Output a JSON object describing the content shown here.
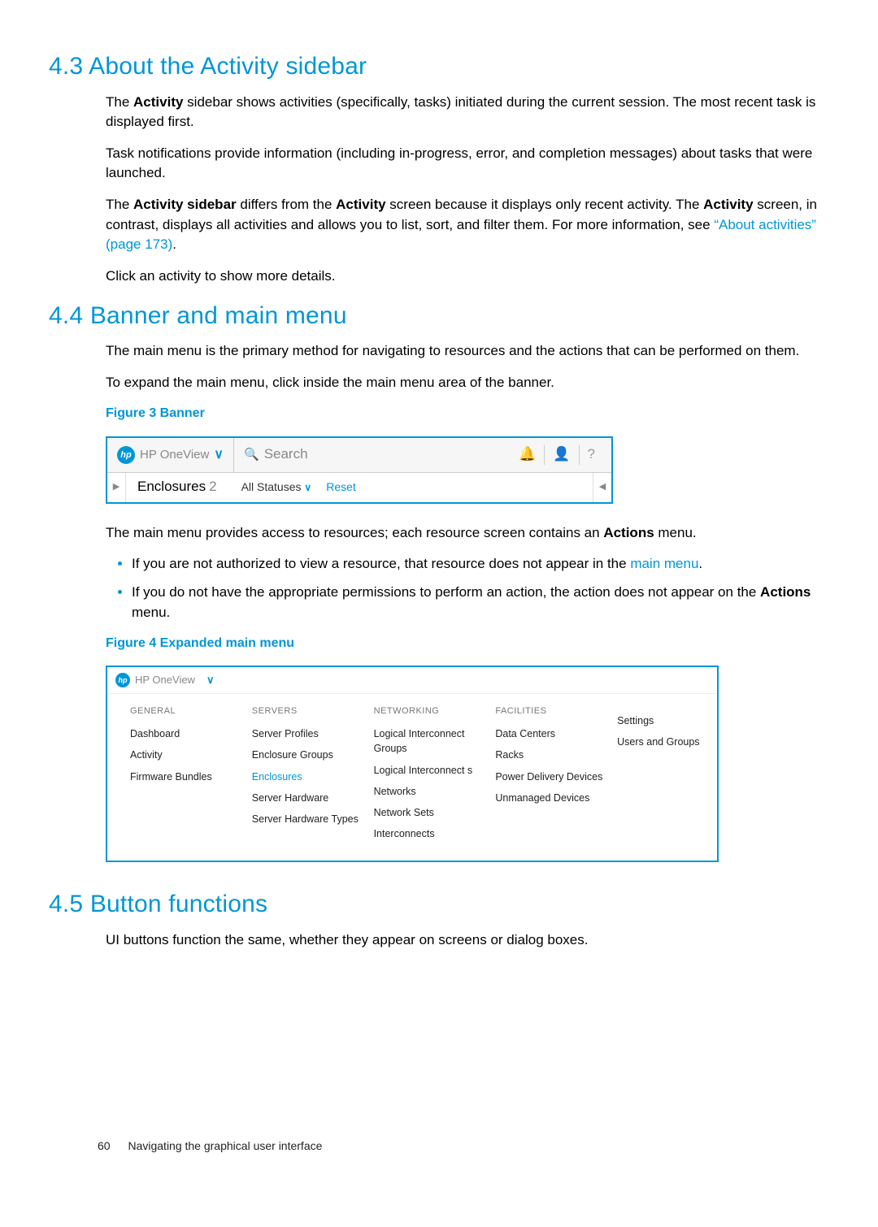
{
  "sections": {
    "s43": {
      "title": "4.3 About the Activity sidebar",
      "p1a": "The ",
      "p1b": "Activity",
      "p1c": " sidebar shows activities (specifically, tasks) initiated during the current session. The most recent task is displayed first.",
      "p2": "Task notifications provide information (including in-progress, error, and completion messages) about tasks that were launched.",
      "p3a": "The ",
      "p3b": "Activity sidebar",
      "p3c": " differs from the ",
      "p3d": "Activity",
      "p3e": " screen because it displays only recent activity. The ",
      "p3f": "Activity",
      "p3g": " screen, in contrast, displays all activities and allows you to list, sort, and filter them. For more information, see ",
      "p3link": "“About activities” (page 173)",
      "p3h": ".",
      "p4": "Click an activity to show more details."
    },
    "s44": {
      "title": "4.4 Banner and main menu",
      "p1": "The main menu is the primary method for navigating to resources and the actions that can be performed on them.",
      "p2": "To expand the main menu, click inside the main menu area of the banner.",
      "fig3": "Figure 3 Banner",
      "after1a": "The main menu provides access to resources; each resource screen contains an ",
      "after1b": "Actions",
      "after1c": " menu.",
      "bullet1a": "If you are not authorized to view a resource, that resource does not appear in the ",
      "bullet1link": "main menu",
      "bullet1b": ".",
      "bullet2a": "If you do not have the appropriate permissions to perform an action, the action does not appear on the ",
      "bullet2b": "Actions",
      "bullet2c": " menu.",
      "fig4": "Figure 4 Expanded main menu"
    },
    "s45": {
      "title": "4.5 Button functions",
      "p1": "UI buttons function the same, whether they appear on screens or dialog boxes."
    }
  },
  "banner": {
    "brand": "HP OneView",
    "logo": "hp",
    "search_placeholder": "Search",
    "bell": "🔔",
    "user": "👤",
    "help": "?",
    "enclosures_label": "Enclosures",
    "enclosures_count": "2",
    "all_statuses": "All Statuses",
    "reset": "Reset"
  },
  "expanded_menu": {
    "brand": "HP OneView",
    "columns": [
      {
        "header": "GENERAL",
        "items": [
          "Dashboard",
          "Activity",
          "Firmware Bundles"
        ]
      },
      {
        "header": "SERVERS",
        "items": [
          "Server Profiles",
          "Enclosure Groups",
          "Enclosures",
          "Server Hardware",
          "Server Hardware Types"
        ],
        "active_index": 2
      },
      {
        "header": "NETWORKING",
        "items": [
          "Logical Interconnect Groups",
          "Logical Interconnect s",
          "Networks",
          "Network Sets",
          "Interconnects"
        ]
      },
      {
        "header": "FACILITIES",
        "items": [
          "Data Centers",
          "Racks",
          "Power Delivery Devices",
          "Unmanaged Devices"
        ]
      },
      {
        "header": "",
        "items": [
          "Settings",
          "Users and Groups"
        ]
      }
    ]
  },
  "footer": {
    "page": "60",
    "chapter": "Navigating the graphical user interface"
  }
}
